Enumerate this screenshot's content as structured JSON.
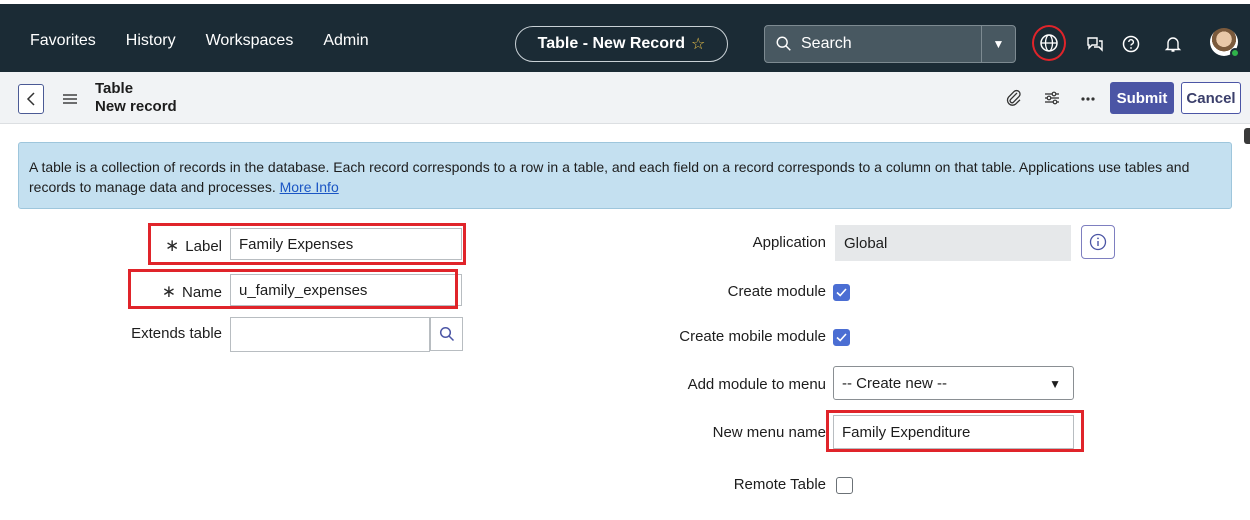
{
  "topnav": {
    "links": [
      "Favorites",
      "History",
      "Workspaces",
      "Admin"
    ],
    "record_title": "Table - New Record",
    "search_label": "Search"
  },
  "subbar": {
    "title": "Table",
    "subtitle": "New record",
    "submit_label": "Submit",
    "cancel_label": "Cancel"
  },
  "info": {
    "text": "A table is a collection of records in the database. Each record corresponds to a row in a table, and each field on a record corresponds to a column on that table. Applications use tables and records to manage data and processes.",
    "link": "More Info"
  },
  "form": {
    "label_label": "Label",
    "label_value": "Family Expenses",
    "name_label": "Name",
    "name_value": "u_family_expenses",
    "extends_label": "Extends table",
    "extends_value": "",
    "application_label": "Application",
    "application_value": "Global",
    "create_module_label": "Create module",
    "create_module_checked": true,
    "create_mobile_module_label": "Create mobile module",
    "create_mobile_module_checked": true,
    "add_module_label": "Add module to menu",
    "add_module_value": "-- Create new --",
    "new_menu_label": "New menu name",
    "new_menu_value": "Family Expenditure",
    "remote_table_label": "Remote Table",
    "remote_table_checked": false
  },
  "colors": {
    "nav_bg": "#1b2b35",
    "accent": "#4b55a5",
    "highlight": "#e0242a",
    "info_bg": "#c4e0f0"
  }
}
